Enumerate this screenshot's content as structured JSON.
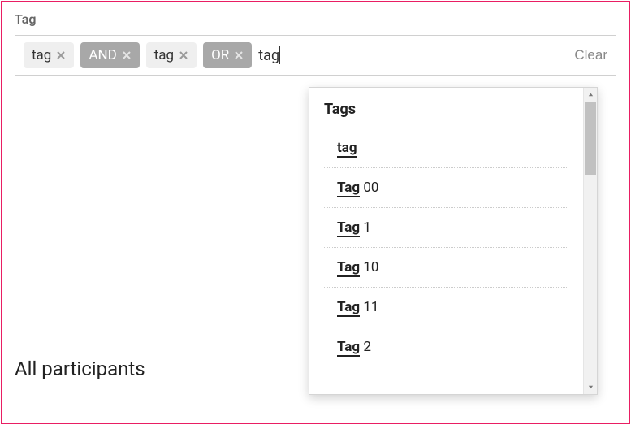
{
  "field": {
    "label": "Tag",
    "clear_label": "Clear",
    "input_value": "tag"
  },
  "chips": [
    {
      "label": "tag",
      "type": "tag"
    },
    {
      "label": "AND",
      "type": "operator"
    },
    {
      "label": "tag",
      "type": "tag"
    },
    {
      "label": "OR",
      "type": "operator"
    }
  ],
  "dropdown": {
    "header": "Tags",
    "items": [
      {
        "match": "tag",
        "rest": "",
        "bold_all": true
      },
      {
        "match": "Tag",
        "rest": " 00"
      },
      {
        "match": "Tag",
        "rest": " 1"
      },
      {
        "match": "Tag",
        "rest": " 10"
      },
      {
        "match": "Tag",
        "rest": " 11"
      },
      {
        "match": "Tag",
        "rest": " 2"
      }
    ]
  },
  "section": {
    "title": "All participants"
  }
}
